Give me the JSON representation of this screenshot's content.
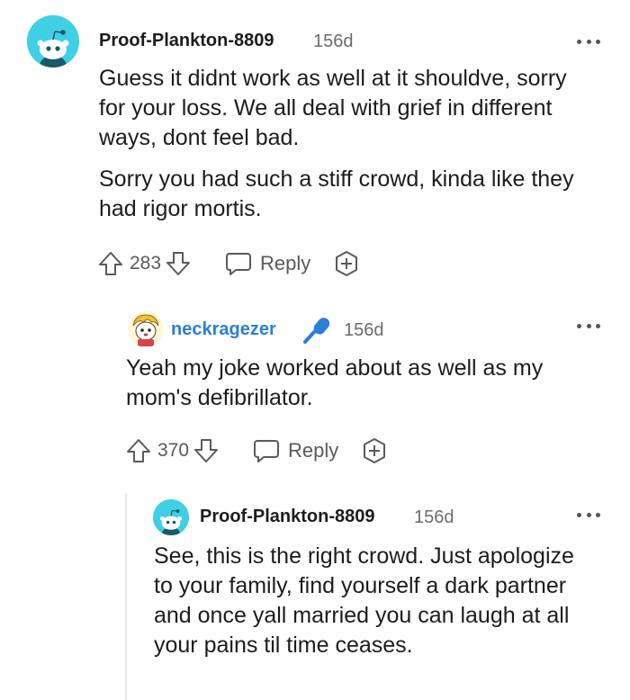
{
  "comments": [
    {
      "username": "Proof-Plankton-8809",
      "time": "156d",
      "paragraphs": [
        "Guess it didnt work as well at it shouldve, sorry for your loss. We all deal with grief in different ways, dont feel bad.",
        "Sorry you had such a stiff crowd, kinda like they had rigor mortis."
      ],
      "votes": "283",
      "reply_label": "Reply"
    },
    {
      "username": "neckragezer",
      "time": "156d",
      "paragraphs": [
        "Yeah my joke worked about as well as my mom's defibrillator."
      ],
      "votes": "370",
      "reply_label": "Reply"
    },
    {
      "username": "Proof-Plankton-8809",
      "time": "156d",
      "paragraphs": [
        "See, this is the right crowd. Just apologize to your family, find yourself a dark partner and once yall married you can laugh at all your pains til time ceases."
      ]
    }
  ],
  "colors": {
    "avatar_bg": "#3fd0e6",
    "flair_blue": "#2a7fd6",
    "thread_line": "#e6e6e6"
  },
  "icons": [
    "snoo-avatar-icon",
    "more-options-icon",
    "upvote-icon",
    "downvote-icon",
    "reply-icon",
    "award-icon",
    "microphone-flair-icon"
  ]
}
